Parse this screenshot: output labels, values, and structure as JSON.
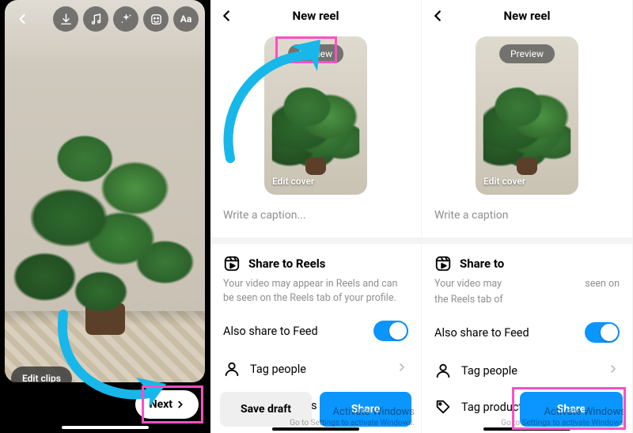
{
  "screen1": {
    "toolbar_icons": [
      "download-icon",
      "music-icon",
      "sparkle-icon",
      "sticker-icon",
      "text-icon"
    ],
    "text_icon_label": "Aa",
    "edit_clips_label": "Edit clips",
    "next_label": "Next"
  },
  "screen2": {
    "header_title": "New reel",
    "preview_label": "Preview",
    "edit_cover_label": "Edit cover",
    "caption_placeholder": "Write a caption...",
    "share_section_title": "Share to Reels",
    "share_section_desc": "Your video may appear in Reels and can be seen on the Reels tab of your profile.",
    "also_share_label": "Also share to Feed",
    "also_share_on": true,
    "rows": [
      {
        "icon": "user-icon",
        "label": "Tag people"
      },
      {
        "icon": "tag-icon",
        "label": "Tag products"
      }
    ],
    "draft_label": "Save draft",
    "share_label": "Share"
  },
  "screen3": {
    "header_title": "New reel",
    "preview_label": "Preview",
    "edit_cover_label": "Edit cover",
    "caption_placeholder": "Write a caption",
    "share_section_title": "Share to",
    "share_section_desc_1": "Your video may",
    "share_section_desc_2": "seen on",
    "share_section_desc_3": "the Reels tab of",
    "also_share_label": "Also share to Feed",
    "also_share_on": true,
    "rows": [
      {
        "icon": "user-icon",
        "label": "Tag people"
      },
      {
        "icon": "tag-icon",
        "label": "Tag products"
      }
    ],
    "share_label": "Share"
  },
  "watermark": {
    "title": "Activate Windows",
    "sub": "Go to Settings to activate Windows."
  },
  "colors": {
    "accent": "#0a95ff",
    "annotation_pink": "#ff4fc2",
    "annotation_blue": "#18b7ea"
  }
}
